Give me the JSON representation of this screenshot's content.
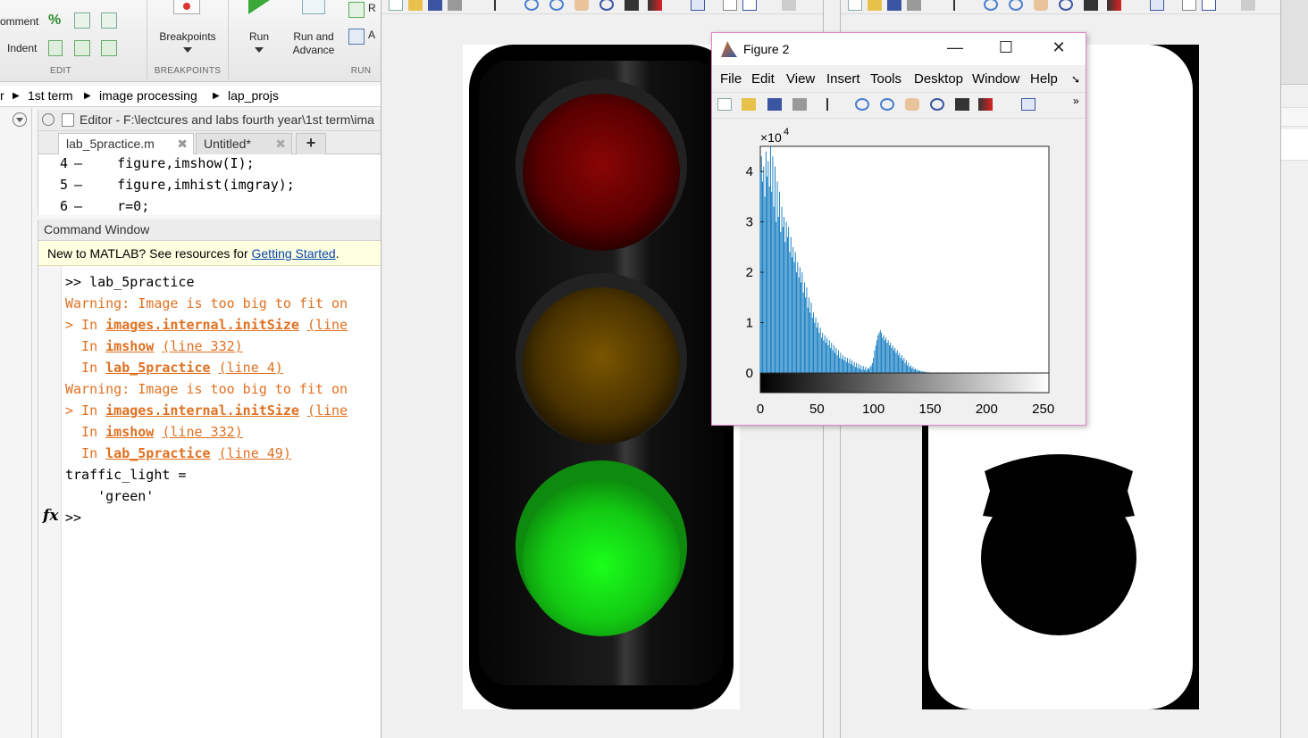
{
  "ribbon": {
    "comment_label": "omment",
    "indent_label": "Indent",
    "breakpoints_label": "Breakpoints",
    "run_label": "Run",
    "run_advance_label_1": "Run and",
    "run_advance_label_2": "Advance",
    "run_section_label_r": "R",
    "run_section_label_a": "A",
    "group_edit": "EDIT",
    "group_breakpoints": "BREAKPOINTS",
    "group_run": "RUN"
  },
  "address": {
    "crumbs": [
      "r",
      "1st term",
      "image processing",
      "lap_projs"
    ]
  },
  "editor": {
    "title": "Editor - F:\\lectcures and labs fourth year\\1st term\\ima",
    "tabs": [
      {
        "label": "lab_5practice.m"
      },
      {
        "label": "Untitled*"
      }
    ],
    "new_tab": "+",
    "lines": [
      {
        "num": "4",
        "dash": "–",
        "code": "    figure,imshow(I);"
      },
      {
        "num": "5",
        "dash": "–",
        "code": "    figure,imhist(imgray);"
      },
      {
        "num": "6",
        "dash": "–",
        "code": "    r=0;"
      }
    ]
  },
  "command_window": {
    "title": "Command Window",
    "notice_text": "New to MATLAB? See resources for ",
    "notice_link": "Getting Started",
    "notice_end": ".",
    "prompt_line": ">> lab_5practice",
    "warning": "Warning: Image is too big to fit on",
    "in_prefix_arrow": "> In ",
    "in_prefix": "  In ",
    "init_size": "images.internal.initSize",
    "line_open": "(line",
    "imshow": "imshow",
    "line_332": "(line 332)",
    "lab5": "lab_5practice",
    "line_4": "(line 4)",
    "line_49": "(line 49)",
    "result_var": "traffic_light =",
    "result_val": "    'green'",
    "fx": "fx",
    "final_prompt": ">>"
  },
  "figure2": {
    "title": "Figure 2",
    "menu": [
      "File",
      "Edit",
      "View",
      "Insert",
      "Tools",
      "Desktop",
      "Window",
      "Help"
    ],
    "minimize": "—",
    "maximize": "☐",
    "close": "✕"
  },
  "chart_data": {
    "type": "bar",
    "title": "",
    "xlabel": "",
    "ylabel": "",
    "xlim": [
      0,
      255
    ],
    "ylim": [
      0,
      45000
    ],
    "exponent_label": "×10",
    "exponent_power": "4",
    "xticks": [
      "0",
      "50",
      "100",
      "150",
      "200",
      "250"
    ],
    "yticks": [
      "0",
      "1",
      "2",
      "3",
      "4"
    ],
    "bar_color": "#0072bd",
    "x_step": 1,
    "values": [
      40000,
      43000,
      38000,
      41000,
      35000,
      44000,
      39000,
      42000,
      37000,
      45000,
      36000,
      43000,
      33000,
      41000,
      30000,
      38000,
      31000,
      36000,
      28000,
      33000,
      29000,
      31000,
      26000,
      30000,
      27000,
      29000,
      24000,
      27000,
      23000,
      25000,
      22000,
      24000,
      20000,
      22000,
      19000,
      21000,
      18000,
      20000,
      16000,
      18000,
      15000,
      17000,
      13000,
      15000,
      12000,
      14000,
      11000,
      12000,
      10000,
      11000,
      9000,
      10000,
      8000,
      9000,
      7000,
      8000,
      6500,
      7500,
      6000,
      7000,
      5500,
      6500,
      5000,
      6000,
      4500,
      5500,
      4000,
      5000,
      3500,
      4500,
      3000,
      4000,
      2800,
      3500,
      2500,
      3200,
      2200,
      3000,
      2000,
      2800,
      1800,
      2500,
      1500,
      2200,
      1200,
      2000,
      1000,
      1800,
      800,
      1500,
      700,
      1400,
      600,
      1200,
      600,
      1000,
      800,
      1200,
      1500,
      2000,
      3000,
      4500,
      5500,
      6500,
      7500,
      8000,
      8500,
      8000,
      7000,
      7500,
      6500,
      7000,
      6000,
      6500,
      5500,
      6000,
      5000,
      5500,
      4500,
      5000,
      4000,
      4500,
      3500,
      4000,
      3000,
      3500,
      2500,
      3000,
      2000,
      2500,
      1500,
      2000,
      1200,
      1500,
      900,
      1200,
      700,
      900,
      500,
      700,
      400,
      500,
      300,
      400,
      200,
      300,
      150,
      200,
      100,
      150,
      80,
      100,
      60,
      80,
      50,
      60,
      40,
      50,
      30,
      40,
      20,
      30,
      20,
      20,
      10,
      20,
      10,
      10,
      10,
      10,
      5,
      10,
      5,
      5,
      5,
      5,
      5,
      5,
      5,
      5,
      5,
      5,
      5,
      5,
      5,
      5,
      5,
      5,
      5,
      5,
      5,
      5,
      5,
      5,
      5,
      5,
      5,
      5,
      5,
      5,
      5,
      5,
      5,
      5,
      5,
      5,
      5,
      5,
      5,
      5,
      5,
      5,
      5,
      5,
      5,
      5,
      5,
      5,
      5,
      5,
      5,
      5,
      5,
      5,
      5,
      5,
      5,
      5,
      5,
      5,
      5,
      5,
      5,
      5,
      5,
      5,
      5,
      5,
      5,
      5,
      5,
      5,
      5,
      5,
      5,
      5,
      5,
      5,
      5,
      5,
      5,
      5,
      5,
      5,
      5,
      5,
      5,
      5,
      5
    ]
  }
}
